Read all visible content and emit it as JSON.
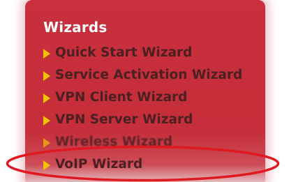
{
  "wizards": {
    "title": "Wizards",
    "items": [
      {
        "label": "Quick Start Wizard"
      },
      {
        "label": "Service Activation Wizard"
      },
      {
        "label": "VPN Client Wizard"
      },
      {
        "label": "VPN Server Wizard"
      },
      {
        "label": "Wireless Wizard"
      },
      {
        "label": "VoIP Wizard"
      }
    ]
  },
  "highlight": {
    "target": "VoIP Wizard",
    "color": "#e01822"
  },
  "colors": {
    "panel_bg": "#c92f3c",
    "title_text": "#ffffff",
    "item_text": "#4a2022",
    "arrow": "#f2c200"
  },
  "icons": {
    "menu_bullet": "arrow-right-icon"
  }
}
